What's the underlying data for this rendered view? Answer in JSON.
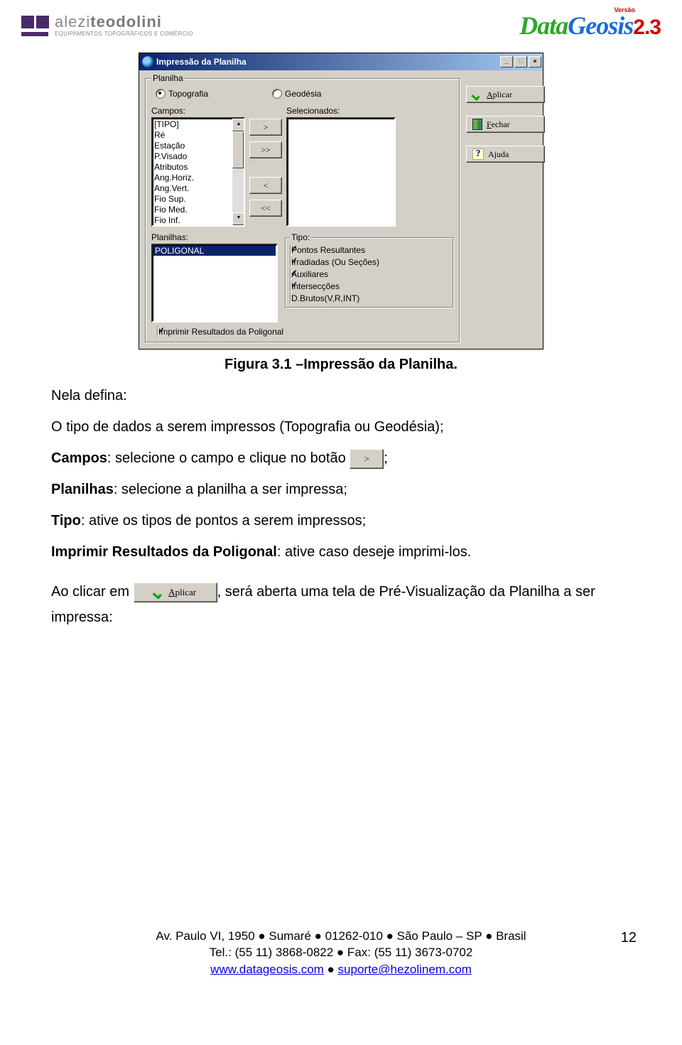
{
  "header": {
    "leftBrandMain": "alezi",
    "leftBrandBold": "teodolini",
    "leftBrandSub": "EQUIPAMENTOS TOPOGRÁFICOS E COMÉRCIO",
    "rightBrand1": "Data",
    "rightBrand2": "Geosis",
    "rightVersionLabel": "Versão",
    "rightVersionNum": "2.3"
  },
  "dialog": {
    "title": "Impressão da Planilha",
    "groupPlanilha": "Planilha",
    "radioTopografia": "Topografia",
    "radioGeodesia": "Geodésia",
    "lblCampos": "Campos:",
    "lblSelecionados": "Selecionados:",
    "campos": [
      "[TIPO]",
      "Ré",
      "Estação",
      "P.Visado",
      "Atributos",
      "Ang.Horiz.",
      "Ang.Vert.",
      "Fio Sup.",
      "Fio Med.",
      "Fio Inf."
    ],
    "btnRight": ">",
    "btnRightAll": ">>",
    "btnLeft": "<",
    "btnLeftAll": "<<",
    "lblPlanilhas": "Planilhas:",
    "planilhas": [
      "POLIGONAL"
    ],
    "groupTipo": "Tipo:",
    "tipoItems": [
      {
        "label": "Pontos Resultantes",
        "checked": true
      },
      {
        "label": "Irradiadas (Ou Seções)",
        "checked": true
      },
      {
        "label": "Auxiliares",
        "checked": true
      },
      {
        "label": "Intersecções",
        "checked": true
      },
      {
        "label": "D.Brutos(V,R,INT)",
        "checked": false
      }
    ],
    "chkImprimirResultados": "Imprimir Resultados da Poligonal",
    "btnAplicar": "Aplicar",
    "btnFechar": "Fechar",
    "btnAjuda": "Ajuda"
  },
  "figure": {
    "caption": "Figura 3.1 –Impressão da Planilha."
  },
  "body": {
    "p1": "Nela defina:",
    "p2": "O tipo de dados a serem impressos (Topografia ou Geodésia);",
    "p3a": "Campos",
    "p3b": ": selecione o campo e clique no botão ",
    "p3btn": ">",
    "p3c": ";",
    "p4a": "Planilhas",
    "p4b": ": selecione a planilha a ser impressa;",
    "p5a": "Tipo",
    "p5b": ": ative os tipos de pontos a serem impressos;",
    "p6a": "Imprimir Resultados da Poligonal",
    "p6b": ": ative caso deseje imprimi-los.",
    "p7a": "Ao clicar em ",
    "p7btn": "Aplicar",
    "p7b": ", será aberta uma tela de Pré-Visualização da Planilha a ser impressa:"
  },
  "footer": {
    "line1": "Av. Paulo VI, 1950 ● Sumaré ● 01262-010 ● São Paulo – SP ● Brasil",
    "line2": "Tel.: (55 11) 3868-0822 ● Fax: (55 11) 3673-0702",
    "link1": "www.datageosis.com",
    "linkSep": " ● ",
    "link2": "suporte@hezolinem.com",
    "pageNum": "12"
  }
}
